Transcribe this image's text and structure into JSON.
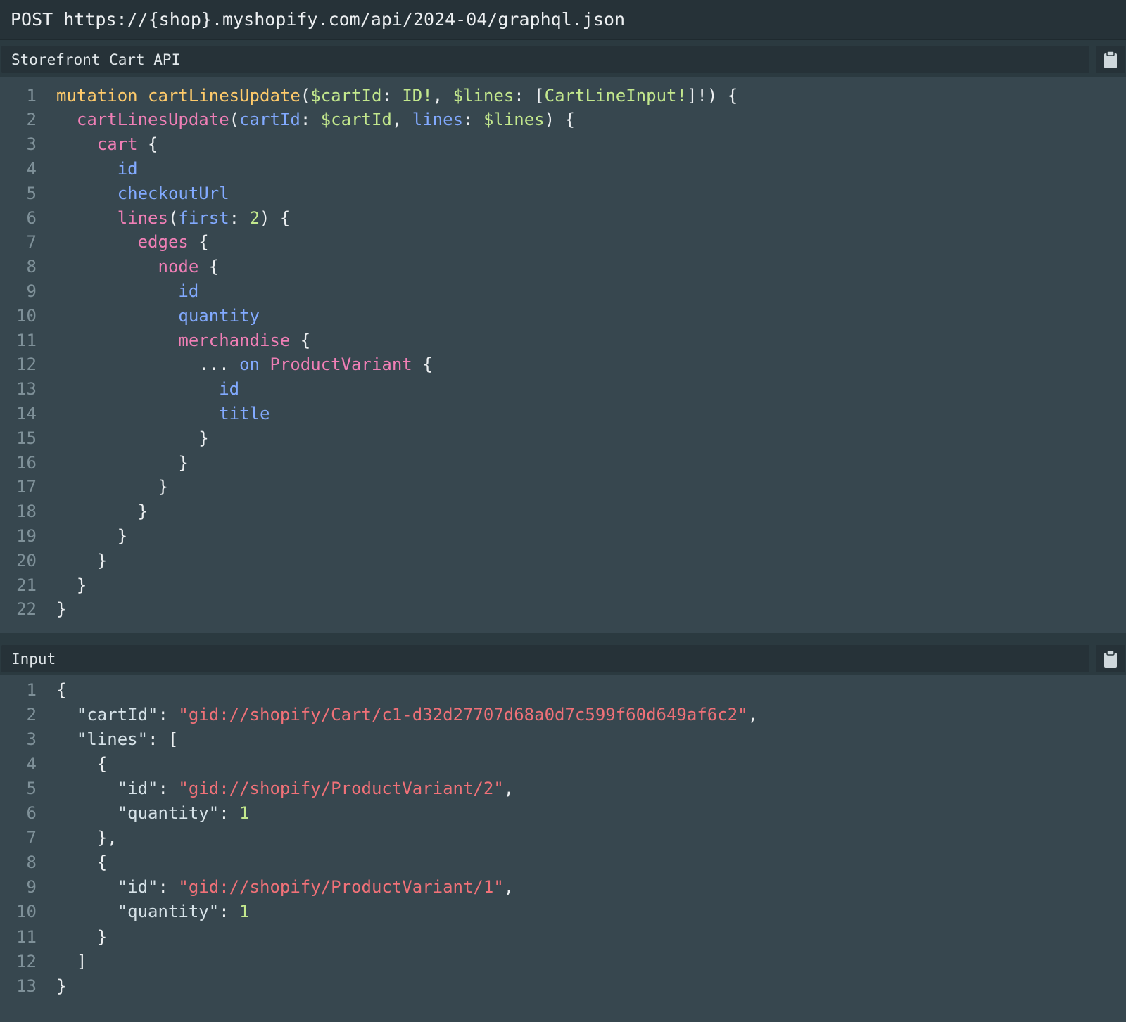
{
  "request": {
    "method": "POST",
    "url": "https://{shop}.myshopify.com/api/2024-04/graphql.json"
  },
  "query_panel": {
    "title": "Storefront Cart API",
    "copy_icon": "clipboard-icon",
    "lines": [
      [
        [
          "kw",
          "mutation "
        ],
        [
          "fn",
          "cartLinesUpdate"
        ],
        [
          "punc",
          "("
        ],
        [
          "var",
          "$cartId"
        ],
        [
          "punc",
          ": "
        ],
        [
          "type",
          "ID!"
        ],
        [
          "punc",
          ", "
        ],
        [
          "var",
          "$lines"
        ],
        [
          "punc",
          ": ["
        ],
        [
          "type",
          "CartLineInput!"
        ],
        [
          "punc",
          "]!) {"
        ]
      ],
      [
        [
          "punc",
          "  "
        ],
        [
          "field",
          "cartLinesUpdate"
        ],
        [
          "punc",
          "("
        ],
        [
          "leaf",
          "cartId"
        ],
        [
          "punc",
          ": "
        ],
        [
          "var",
          "$cartId"
        ],
        [
          "punc",
          ", "
        ],
        [
          "leaf",
          "lines"
        ],
        [
          "punc",
          ": "
        ],
        [
          "var",
          "$lines"
        ],
        [
          "punc",
          ") {"
        ]
      ],
      [
        [
          "punc",
          "    "
        ],
        [
          "field",
          "cart"
        ],
        [
          "punc",
          " {"
        ]
      ],
      [
        [
          "punc",
          "      "
        ],
        [
          "leaf",
          "id"
        ]
      ],
      [
        [
          "punc",
          "      "
        ],
        [
          "leaf",
          "checkoutUrl"
        ]
      ],
      [
        [
          "punc",
          "      "
        ],
        [
          "field",
          "lines"
        ],
        [
          "punc",
          "("
        ],
        [
          "leaf",
          "first"
        ],
        [
          "punc",
          ": "
        ],
        [
          "num",
          "2"
        ],
        [
          "punc",
          ") {"
        ]
      ],
      [
        [
          "punc",
          "        "
        ],
        [
          "field",
          "edges"
        ],
        [
          "punc",
          " {"
        ]
      ],
      [
        [
          "punc",
          "          "
        ],
        [
          "field",
          "node"
        ],
        [
          "punc",
          " {"
        ]
      ],
      [
        [
          "punc",
          "            "
        ],
        [
          "leaf",
          "id"
        ]
      ],
      [
        [
          "punc",
          "            "
        ],
        [
          "leaf",
          "quantity"
        ]
      ],
      [
        [
          "punc",
          "            "
        ],
        [
          "field",
          "merchandise"
        ],
        [
          "punc",
          " {"
        ]
      ],
      [
        [
          "punc",
          "              ... "
        ],
        [
          "on",
          "on "
        ],
        [
          "frag",
          "ProductVariant"
        ],
        [
          "punc",
          " {"
        ]
      ],
      [
        [
          "punc",
          "                "
        ],
        [
          "leaf",
          "id"
        ]
      ],
      [
        [
          "punc",
          "                "
        ],
        [
          "leaf",
          "title"
        ]
      ],
      [
        [
          "punc",
          "              }"
        ]
      ],
      [
        [
          "punc",
          "            }"
        ]
      ],
      [
        [
          "punc",
          "          }"
        ]
      ],
      [
        [
          "punc",
          "        }"
        ]
      ],
      [
        [
          "punc",
          "      }"
        ]
      ],
      [
        [
          "punc",
          "    }"
        ]
      ],
      [
        [
          "punc",
          "  }"
        ]
      ],
      [
        [
          "punc",
          "}"
        ]
      ]
    ]
  },
  "input_panel": {
    "title": "Input",
    "copy_icon": "clipboard-icon",
    "lines": [
      [
        [
          "punc",
          "{"
        ]
      ],
      [
        [
          "punc",
          "  "
        ],
        [
          "key",
          "\"cartId\""
        ],
        [
          "punc",
          ": "
        ],
        [
          "str",
          "\"gid://shopify/Cart/c1-d32d27707d68a0d7c599f60d649af6c2\""
        ],
        [
          "punc",
          ","
        ]
      ],
      [
        [
          "punc",
          "  "
        ],
        [
          "key",
          "\"lines\""
        ],
        [
          "punc",
          ": ["
        ]
      ],
      [
        [
          "punc",
          "    {"
        ]
      ],
      [
        [
          "punc",
          "      "
        ],
        [
          "key",
          "\"id\""
        ],
        [
          "punc",
          ": "
        ],
        [
          "str",
          "\"gid://shopify/ProductVariant/2\""
        ],
        [
          "punc",
          ","
        ]
      ],
      [
        [
          "punc",
          "      "
        ],
        [
          "key",
          "\"quantity\""
        ],
        [
          "punc",
          ": "
        ],
        [
          "num",
          "1"
        ]
      ],
      [
        [
          "punc",
          "    },"
        ]
      ],
      [
        [
          "punc",
          "    {"
        ]
      ],
      [
        [
          "punc",
          "      "
        ],
        [
          "key",
          "\"id\""
        ],
        [
          "punc",
          ": "
        ],
        [
          "str",
          "\"gid://shopify/ProductVariant/1\""
        ],
        [
          "punc",
          ","
        ]
      ],
      [
        [
          "punc",
          "      "
        ],
        [
          "key",
          "\"quantity\""
        ],
        [
          "punc",
          ": "
        ],
        [
          "num",
          "1"
        ]
      ],
      [
        [
          "punc",
          "    }"
        ]
      ],
      [
        [
          "punc",
          "  ]"
        ]
      ],
      [
        [
          "punc",
          "}"
        ]
      ]
    ]
  }
}
